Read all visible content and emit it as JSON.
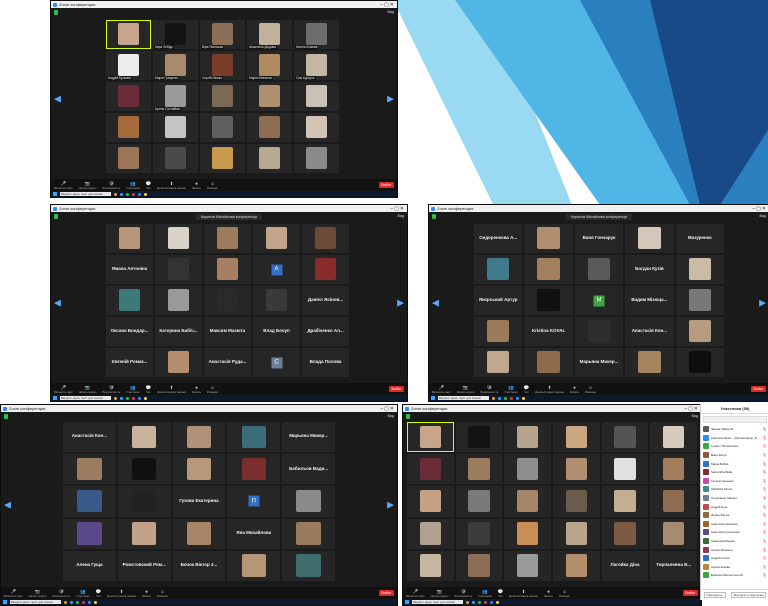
{
  "theme": {
    "tile_bg": "#262626",
    "accent": "#d4ff00",
    "brand": "#2d8cff",
    "end": "#e02828"
  },
  "windows": [
    {
      "title": "Zoom конференция",
      "meeting": "",
      "view": "Вид",
      "cols": 5,
      "tiles": [
        {
          "name": "",
          "kind": "face",
          "color": "#c7a58a",
          "active": true
        },
        {
          "name": "Кира Лебідь",
          "kind": "face",
          "color": "#141414"
        },
        {
          "name": "Віра Ясинська",
          "kind": "face",
          "color": "#8c6f56"
        },
        {
          "name": "Анастасія Дюдова",
          "kind": "face",
          "color": "#c2b19c"
        },
        {
          "name": "Ксенія Кічаєва",
          "kind": "face",
          "color": "#6d6d6d"
        },
        {
          "name": "Андрій Кузьмин",
          "kind": "face",
          "color": "#ececec"
        },
        {
          "name": "Марія Гриценко",
          "kind": "face",
          "color": "#a88a6d"
        },
        {
          "name": "Сергій Ляшко",
          "kind": "face",
          "color": "#7a3d2a"
        },
        {
          "name": "Марія Бевзенко",
          "kind": "face",
          "color": "#b08a60"
        },
        {
          "name": "Оля Куркуль",
          "kind": "face",
          "color": "#c4b7a6"
        },
        {
          "name": "",
          "kind": "face",
          "color": "#6b2c3a"
        },
        {
          "name": "Артем Соловйов",
          "kind": "face",
          "color": "#9a9a9a"
        },
        {
          "name": "",
          "kind": "face",
          "color": "#7a6a55"
        },
        {
          "name": "",
          "kind": "face",
          "color": "#b0916f"
        },
        {
          "name": "",
          "kind": "face",
          "color": "#c9c1b5"
        },
        {
          "name": "",
          "kind": "face",
          "color": "#a36a3c"
        },
        {
          "name": "",
          "kind": "face",
          "color": "#c4c4c4"
        },
        {
          "name": "",
          "kind": "face",
          "color": "#5f5f5f"
        },
        {
          "name": "",
          "kind": "face",
          "color": "#8e6d52"
        },
        {
          "name": "",
          "kind": "face",
          "color": "#d2c3b5"
        },
        {
          "name": "",
          "kind": "face",
          "color": "#9c7558"
        },
        {
          "name": "",
          "kind": "face",
          "color": "#4a4a4a"
        },
        {
          "name": "",
          "kind": "face",
          "color": "#c89a4e"
        },
        {
          "name": "",
          "kind": "face",
          "color": "#b7a893"
        },
        {
          "name": "",
          "kind": "face",
          "color": "#8a8a8a"
        }
      ]
    },
    {
      "title": "Zoom конференция",
      "meeting": "Кирилов Михайлова конференція",
      "view": "Вид",
      "cols": 5,
      "tiles": [
        {
          "name": "",
          "kind": "face",
          "color": "#b9967a"
        },
        {
          "name": "",
          "kind": "face",
          "color": "#d8d2c7"
        },
        {
          "name": "",
          "kind": "face",
          "color": "#9b7d5e"
        },
        {
          "name": "",
          "kind": "face",
          "color": "#c2a48a"
        },
        {
          "name": "",
          "kind": "face",
          "color": "#6a4a38"
        },
        {
          "name": "Ямана Антоніна",
          "kind": "text"
        },
        {
          "name": "",
          "kind": "face",
          "color": "#333333"
        },
        {
          "name": "",
          "kind": "face",
          "color": "#a78063"
        },
        {
          "name": "A",
          "kind": "letter",
          "color": "#2f6fc4"
        },
        {
          "name": "",
          "kind": "face",
          "color": "#8a2b2b"
        },
        {
          "name": "",
          "kind": "face",
          "color": "#3c7a7a"
        },
        {
          "name": "",
          "kind": "face",
          "color": "#9a9a9a"
        },
        {
          "name": "",
          "kind": "face",
          "color": "#2a2a2a"
        },
        {
          "name": "",
          "kind": "face",
          "color": "#3a3a3a"
        },
        {
          "name": "Даніел Ясінов...",
          "kind": "text"
        },
        {
          "name": "Оксана Бондар...",
          "kind": "text"
        },
        {
          "name": "Катерина Бабіч...",
          "kind": "text"
        },
        {
          "name": "Максим Мазюта",
          "kind": "text"
        },
        {
          "name": "Влад Бочуп",
          "kind": "text"
        },
        {
          "name": "Драбіченко Ал...",
          "kind": "text"
        },
        {
          "name": "Євгеній Ромак...",
          "kind": "text"
        },
        {
          "name": "",
          "kind": "face",
          "color": "#b58d6d"
        },
        {
          "name": "Анастасія Руда...",
          "kind": "text"
        },
        {
          "name": "C",
          "kind": "letter",
          "color": "#6b7f99"
        },
        {
          "name": "Влада Полова",
          "kind": "text"
        }
      ]
    },
    {
      "title": "Zoom конференция",
      "meeting": "Кирилов Михайлова конференція",
      "view": "Вид",
      "cols": 5,
      "tiles": [
        {
          "name": "Сидоренкова А...",
          "kind": "text"
        },
        {
          "name": "",
          "kind": "face",
          "color": "#b08e70"
        },
        {
          "name": "Ваня Гончарук",
          "kind": "text"
        },
        {
          "name": "",
          "kind": "face",
          "color": "#d3c8ba"
        },
        {
          "name": "Мазуренко",
          "kind": "text"
        },
        {
          "name": "",
          "kind": "face",
          "color": "#3e7a8c"
        },
        {
          "name": "",
          "kind": "face",
          "color": "#a27f5f"
        },
        {
          "name": "",
          "kind": "face",
          "color": "#5a5a5a"
        },
        {
          "name": "Богдан Кузів",
          "kind": "text"
        },
        {
          "name": "",
          "kind": "face",
          "color": "#cbbba6"
        },
        {
          "name": "Якорський Артур",
          "kind": "text"
        },
        {
          "name": "",
          "kind": "face",
          "color": "#111111"
        },
        {
          "name": "M",
          "kind": "letter",
          "color": "#3da642"
        },
        {
          "name": "Вадим Мізюца...",
          "kind": "text"
        },
        {
          "name": "",
          "kind": "face",
          "color": "#777777"
        },
        {
          "name": "",
          "kind": "face",
          "color": "#9b7a5a"
        },
        {
          "name": "Kristina KOVAL",
          "kind": "text"
        },
        {
          "name": "",
          "kind": "face",
          "color": "#2e2e2e"
        },
        {
          "name": "Анастасія Кон...",
          "kind": "text"
        },
        {
          "name": "",
          "kind": "face",
          "color": "#b79b7e"
        },
        {
          "name": "",
          "kind": "face",
          "color": "#c0a88e"
        },
        {
          "name": "",
          "kind": "face",
          "color": "#8e6b4b"
        },
        {
          "name": "Марьяна Микер...",
          "kind": "text"
        },
        {
          "name": "",
          "kind": "face",
          "color": "#a4845f"
        },
        {
          "name": "",
          "kind": "face",
          "color": "#0e0e0e"
        }
      ]
    },
    {
      "title": "Zoom конференция",
      "meeting": "",
      "view": "Вид",
      "cols": 5,
      "tiles": [
        {
          "name": "Анастасія Кон...",
          "kind": "text"
        },
        {
          "name": "",
          "kind": "face",
          "color": "#c9b39c"
        },
        {
          "name": "",
          "kind": "face",
          "color": "#b0917a"
        },
        {
          "name": "",
          "kind": "face",
          "color": "#3b6e7a"
        },
        {
          "name": "Марьяна Микер...",
          "kind": "text"
        },
        {
          "name": "",
          "kind": "face",
          "color": "#9b7c60"
        },
        {
          "name": "",
          "kind": "face",
          "color": "#101010"
        },
        {
          "name": "",
          "kind": "face",
          "color": "#b8987a"
        },
        {
          "name": "",
          "kind": "face",
          "color": "#7a2e2e"
        },
        {
          "name": "Бабильов Вади...",
          "kind": "text"
        },
        {
          "name": "",
          "kind": "face",
          "color": "#3a5a8a"
        },
        {
          "name": "",
          "kind": "face",
          "color": "#222222"
        },
        {
          "name": "Гузова Екатерина",
          "kind": "text"
        },
        {
          "name": "П",
          "kind": "letter",
          "color": "#2f6fc4"
        },
        {
          "name": "",
          "kind": "face",
          "color": "#8a8a8a"
        },
        {
          "name": "",
          "kind": "face",
          "color": "#5b4a8a"
        },
        {
          "name": "",
          "kind": "face",
          "color": "#c2a389"
        },
        {
          "name": "",
          "kind": "face",
          "color": "#a88566"
        },
        {
          "name": "Яна Михайлова",
          "kind": "text"
        },
        {
          "name": "",
          "kind": "face",
          "color": "#9a7a5c"
        },
        {
          "name": "Алена Гуща",
          "kind": "text"
        },
        {
          "name": "Ромстовский Ром...",
          "kind": "text"
        },
        {
          "name": "Бочок Віктор 2...",
          "kind": "text"
        },
        {
          "name": "",
          "kind": "face",
          "color": "#b59676"
        },
        {
          "name": "",
          "kind": "face",
          "color": "#3f6d6d"
        }
      ]
    },
    {
      "title": "Zoom конференция",
      "meeting": "",
      "view": "Вид",
      "cols": 6,
      "tiles": [
        {
          "name": "",
          "kind": "face",
          "color": "#c7a58a",
          "active": true
        },
        {
          "name": "",
          "kind": "face",
          "color": "#131313"
        },
        {
          "name": "",
          "kind": "face",
          "color": "#b7a48f"
        },
        {
          "name": "",
          "kind": "face",
          "color": "#caa781"
        },
        {
          "name": "",
          "kind": "face",
          "color": "#545454"
        },
        {
          "name": "",
          "kind": "face",
          "color": "#d7cbbd"
        },
        {
          "name": "",
          "kind": "face",
          "color": "#6b2c3a"
        },
        {
          "name": "",
          "kind": "face",
          "color": "#9b7c5e"
        },
        {
          "name": "",
          "kind": "face",
          "color": "#8e8e8e"
        },
        {
          "name": "",
          "kind": "face",
          "color": "#b18f70"
        },
        {
          "name": "",
          "kind": "face",
          "color": "#e0e0e0"
        },
        {
          "name": "",
          "kind": "face",
          "color": "#a47e5c"
        },
        {
          "name": "",
          "kind": "face",
          "color": "#c4a283"
        },
        {
          "name": "",
          "kind": "face",
          "color": "#7a7a7a"
        },
        {
          "name": "",
          "kind": "face",
          "color": "#a58668"
        },
        {
          "name": "",
          "kind": "face",
          "color": "#6b5b4b"
        },
        {
          "name": "",
          "kind": "face",
          "color": "#c5ad92"
        },
        {
          "name": "",
          "kind": "face",
          "color": "#8d6c4f"
        },
        {
          "name": "",
          "kind": "face",
          "color": "#b0a090"
        },
        {
          "name": "",
          "kind": "face",
          "color": "#3c3c3c"
        },
        {
          "name": "",
          "kind": "face",
          "color": "#c98e52"
        },
        {
          "name": "",
          "kind": "face",
          "color": "#b9a58d"
        },
        {
          "name": "",
          "kind": "face",
          "color": "#7d5a44"
        },
        {
          "name": "",
          "kind": "face",
          "color": "#a58b70"
        },
        {
          "name": "",
          "kind": "face",
          "color": "#c6b7a2"
        },
        {
          "name": "",
          "kind": "face",
          "color": "#8b6e55"
        },
        {
          "name": "",
          "kind": "face",
          "color": "#9a9a9a"
        },
        {
          "name": "",
          "kind": "face",
          "color": "#b48f6c"
        },
        {
          "name": "Лагойко Діна",
          "kind": "text"
        },
        {
          "name": "Тирпалевна В...",
          "kind": "text"
        }
      ]
    }
  ],
  "toolbar": [
    {
      "icon": "🎤",
      "label": "Включить звук"
    },
    {
      "icon": "📷",
      "label": "Начать видео"
    },
    {
      "icon": "🛡",
      "label": "Безопасность"
    },
    {
      "icon": "👥",
      "label": "Участники"
    },
    {
      "icon": "💬",
      "label": "Чат"
    },
    {
      "icon": "⬆",
      "label": "Демонстрация экрана"
    },
    {
      "icon": "⏺",
      "label": "Запись"
    },
    {
      "icon": "☺",
      "label": "Реакции"
    }
  ],
  "end_label": "Выйти",
  "taskbar": {
    "search": "Введите здесь текст для поиска"
  },
  "participants_panel": {
    "title": "Участники (59)",
    "search": "",
    "rows": [
      {
        "name": "Іванна Чабан 31",
        "color": "#5a5a5a"
      },
      {
        "name": "Кирилов Миха... (Организатор, я)",
        "color": "#2d8cff"
      },
      {
        "name": "Lyubov Tomashenko",
        "color": "#3da642"
      },
      {
        "name": "Ваня Рачук",
        "color": "#8a5a3a"
      },
      {
        "name": "Маріа Бобоk",
        "color": "#2f6fc4"
      },
      {
        "name": "Samantha Bella",
        "color": "#7a2e2e"
      },
      {
        "name": "Тетяна Чашенко",
        "color": "#c24ab0"
      },
      {
        "name": "Vladislav Simon",
        "color": "#3a8a8a"
      },
      {
        "name": "Олександр Мамон",
        "color": "#6b7f99"
      },
      {
        "name": "Андрій Кузь",
        "color": "#c24a4a"
      },
      {
        "name": "Ярина Батюк",
        "color": "#8a6b3a"
      },
      {
        "name": "Анастасія Анікієнко",
        "color": "#a0622b"
      },
      {
        "name": "Анастасія Кулешова",
        "color": "#5b4a8a"
      },
      {
        "name": "Анжеліка Манько",
        "color": "#3a6b3a"
      },
      {
        "name": "Артем Лісевець",
        "color": "#8a3a5a"
      },
      {
        "name": "Андрій Кочан",
        "color": "#2f6fc4"
      },
      {
        "name": "Арина Агаєва",
        "color": "#b08a3a"
      },
      {
        "name": "Бабенко Валентина 20",
        "color": "#3da642"
      }
    ],
    "invite": "Пригласить",
    "mute_all": "Выключить звук всем"
  }
}
